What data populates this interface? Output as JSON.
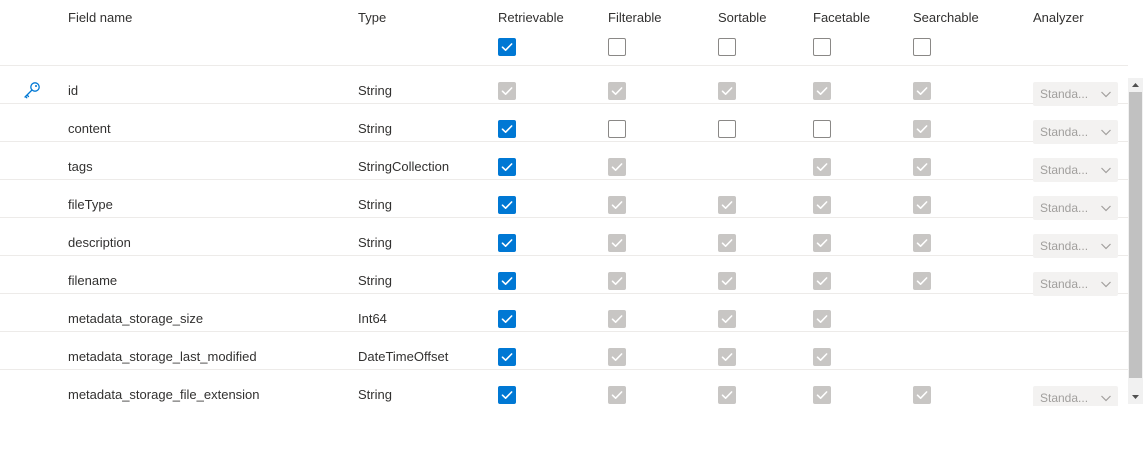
{
  "columns": {
    "field_name": "Field name",
    "type": "Type",
    "retrievable": "Retrievable",
    "filterable": "Filterable",
    "sortable": "Sortable",
    "facetable": "Facetable",
    "searchable": "Searchable",
    "analyzer": "Analyzer"
  },
  "header_checks": {
    "retrievable": "on",
    "filterable": "off",
    "sortable": "off",
    "facetable": "off",
    "searchable": "off"
  },
  "analyzer_default": "Standa...",
  "icons": {
    "key": "key-icon",
    "chevron": "chevron-down-icon",
    "check": "checkmark-icon"
  },
  "colors": {
    "accent": "#0078d4",
    "disabled": "#c8c6c4",
    "border": "#edebe9"
  },
  "rows": [
    {
      "name": "id",
      "type": "String",
      "key": true,
      "retrievable": "dis",
      "filterable": "dis",
      "sortable": "dis",
      "facetable": "dis",
      "searchable": "dis",
      "analyzer": "Standa..."
    },
    {
      "name": "content",
      "type": "String",
      "key": false,
      "retrievable": "on",
      "filterable": "off",
      "sortable": "off",
      "facetable": "off",
      "searchable": "dis",
      "analyzer": "Standa..."
    },
    {
      "name": "tags",
      "type": "StringCollection",
      "key": false,
      "retrievable": "on",
      "filterable": "dis",
      "sortable": "none",
      "facetable": "dis",
      "searchable": "dis",
      "analyzer": "Standa..."
    },
    {
      "name": "fileType",
      "type": "String",
      "key": false,
      "retrievable": "on",
      "filterable": "dis",
      "sortable": "dis",
      "facetable": "dis",
      "searchable": "dis",
      "analyzer": "Standa..."
    },
    {
      "name": "description",
      "type": "String",
      "key": false,
      "retrievable": "on",
      "filterable": "dis",
      "sortable": "dis",
      "facetable": "dis",
      "searchable": "dis",
      "analyzer": "Standa..."
    },
    {
      "name": "filename",
      "type": "String",
      "key": false,
      "retrievable": "on",
      "filterable": "dis",
      "sortable": "dis",
      "facetable": "dis",
      "searchable": "dis",
      "analyzer": "Standa..."
    },
    {
      "name": "metadata_storage_size",
      "type": "Int64",
      "key": false,
      "retrievable": "on",
      "filterable": "dis",
      "sortable": "dis",
      "facetable": "dis",
      "searchable": "none",
      "analyzer": ""
    },
    {
      "name": "metadata_storage_last_modified",
      "type": "DateTimeOffset",
      "key": false,
      "retrievable": "on",
      "filterable": "dis",
      "sortable": "dis",
      "facetable": "dis",
      "searchable": "none",
      "analyzer": ""
    },
    {
      "name": "metadata_storage_file_extension",
      "type": "String",
      "key": false,
      "retrievable": "on",
      "filterable": "dis",
      "sortable": "dis",
      "facetable": "dis",
      "searchable": "dis",
      "analyzer": "Standa..."
    }
  ]
}
